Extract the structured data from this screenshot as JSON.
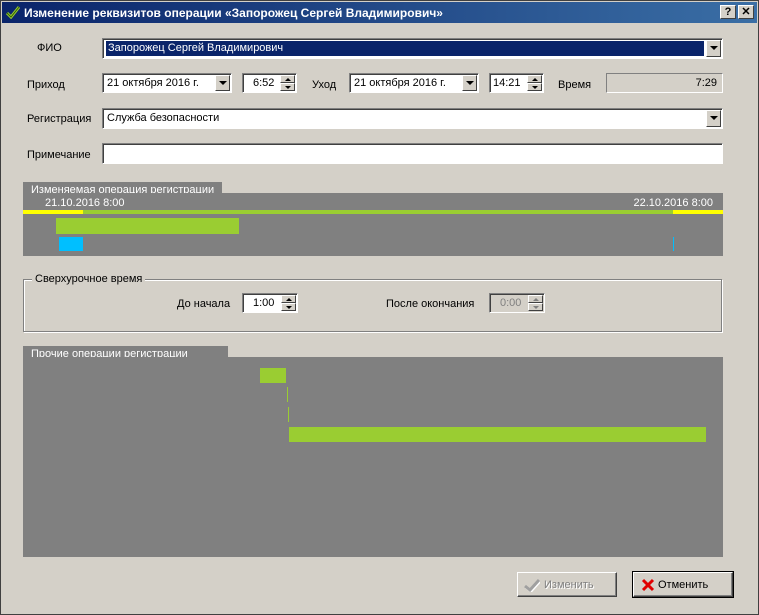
{
  "window": {
    "title": "Изменение реквизитов операции «Запорожец Сергей Владимирович»",
    "help_label": "?",
    "close_label": "✕"
  },
  "fio": {
    "label": "ФИО",
    "value": "Запорожец Сергей Владимирович"
  },
  "arrival": {
    "label": "Приход",
    "date": "21  октября  2016 г.",
    "time": "6:52"
  },
  "departure": {
    "label": "Уход",
    "date": "21  октября  2016 г.",
    "time": "14:21"
  },
  "duration": {
    "label": "Время",
    "value": "7:29"
  },
  "registration": {
    "label": "Регистрация",
    "value": "Служба безопасности"
  },
  "note": {
    "label": "Примечание",
    "value": ""
  },
  "changed_operation": {
    "title": "Изменяемая операция регистрации",
    "start_label": "21.10.2016 8:00",
    "end_label": "22.10.2016 8:00"
  },
  "overtime": {
    "title": "Сверхурочное время",
    "before_label": "До начала",
    "before_value": "1:00",
    "after_label": "После окончания",
    "after_value": "0:00"
  },
  "other_operations": {
    "title": "Прочие операции регистрации"
  },
  "buttons": {
    "change_label": "Изменить",
    "cancel_label": "Отменить"
  },
  "colors": {
    "timeline_bg": "#808080",
    "green": "#9acd32",
    "yellow": "#ffff00",
    "cyan": "#00bfff",
    "selection": "#0a246a"
  }
}
